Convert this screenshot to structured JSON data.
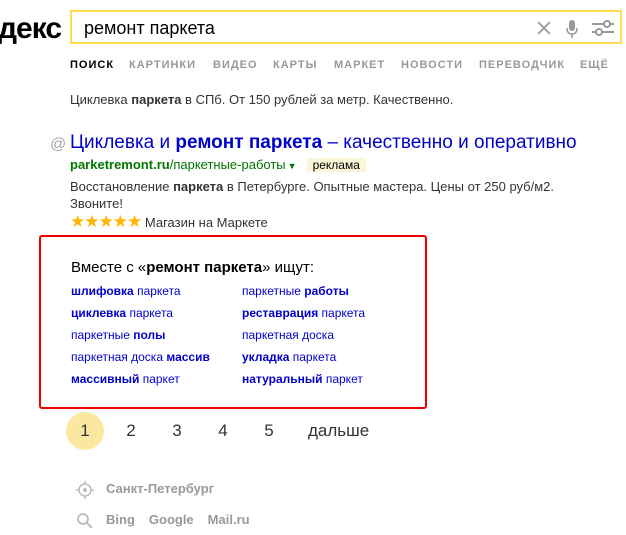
{
  "header": {
    "logo": "декс",
    "search_value": "ремонт паркета"
  },
  "tabs": [
    "ПОИСК",
    "КАРТИНКИ",
    "ВИДЕО",
    "КАРТЫ",
    "МАРКЕТ",
    "НОВОСТИ",
    "ПЕРЕВОДЧИК",
    "ЕЩЁ"
  ],
  "prev_snippet": {
    "pre": "Циклевка ",
    "bold": "паркета",
    "post": " в СПб. От 150 рублей за метр. Качественно."
  },
  "result": {
    "title_pre": "Циклевка и ",
    "title_bold": "ремонт паркета",
    "title_post": " – качественно и оперативно",
    "url_bold": "parketremont.ru",
    "url_path": "/паркетные-работы",
    "ad_label": "реклама",
    "text_1": "Восстановление ",
    "text_bold": "паркета",
    "text_2": " в Петербурге. Опытные мастера. Цены от 250 руб/м2. Звоните!",
    "rating": 5,
    "market_label": "Магазин на Маркете"
  },
  "related": {
    "title_pre": "Вместе с «",
    "title_bold": "ремонт паркета",
    "title_post": "» ищут:",
    "items": [
      {
        "a": "шлифовка",
        "b": " паркета"
      },
      {
        "a": "паркетные ",
        "b": "работы"
      },
      {
        "a": "циклевка",
        "b": " паркета"
      },
      {
        "a": "реставрация",
        "b": " паркета"
      },
      {
        "a": "паркетные ",
        "b": "полы"
      },
      {
        "a": "паркетная доска",
        "b": ""
      },
      {
        "a": "паркетная доска ",
        "b": "массив"
      },
      {
        "a": "укладка",
        "b": " паркета"
      },
      {
        "a": "массивный",
        "b": " паркет"
      },
      {
        "a": "натуральный",
        "b": " паркет"
      }
    ]
  },
  "pager": {
    "pages": [
      "1",
      "2",
      "3",
      "4",
      "5"
    ],
    "current": "1",
    "next": "дальше"
  },
  "footer": {
    "region": "Санкт-Петербург",
    "engines": [
      "Bing",
      "Google",
      "Mail.ru"
    ]
  }
}
